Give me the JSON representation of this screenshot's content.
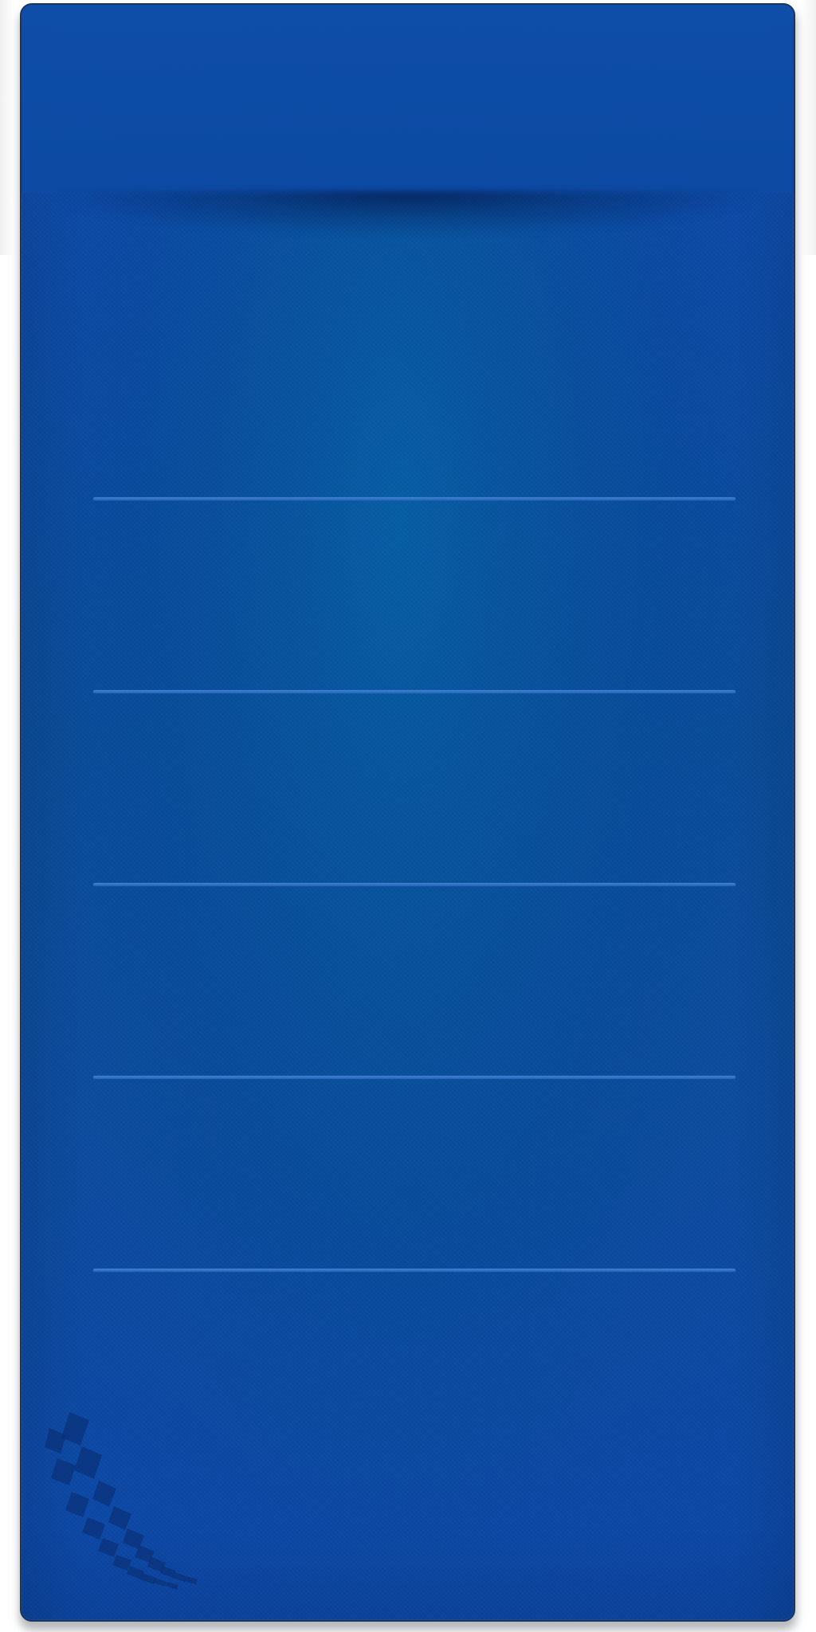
{
  "screen": {
    "type": "blank-list-panel",
    "theme_colors": {
      "outer_background": "#ffffff",
      "panel_blue": "#0c4aa5",
      "panel_center_blue": "#07599d",
      "divider_blue": "#2f74c6",
      "border_dark": "#18345f",
      "tread_mark": "#0a2f75"
    },
    "visible_text": [],
    "decorative_elements": [
      "tire-tread-icon"
    ]
  },
  "list": {
    "row_count": 6
  }
}
